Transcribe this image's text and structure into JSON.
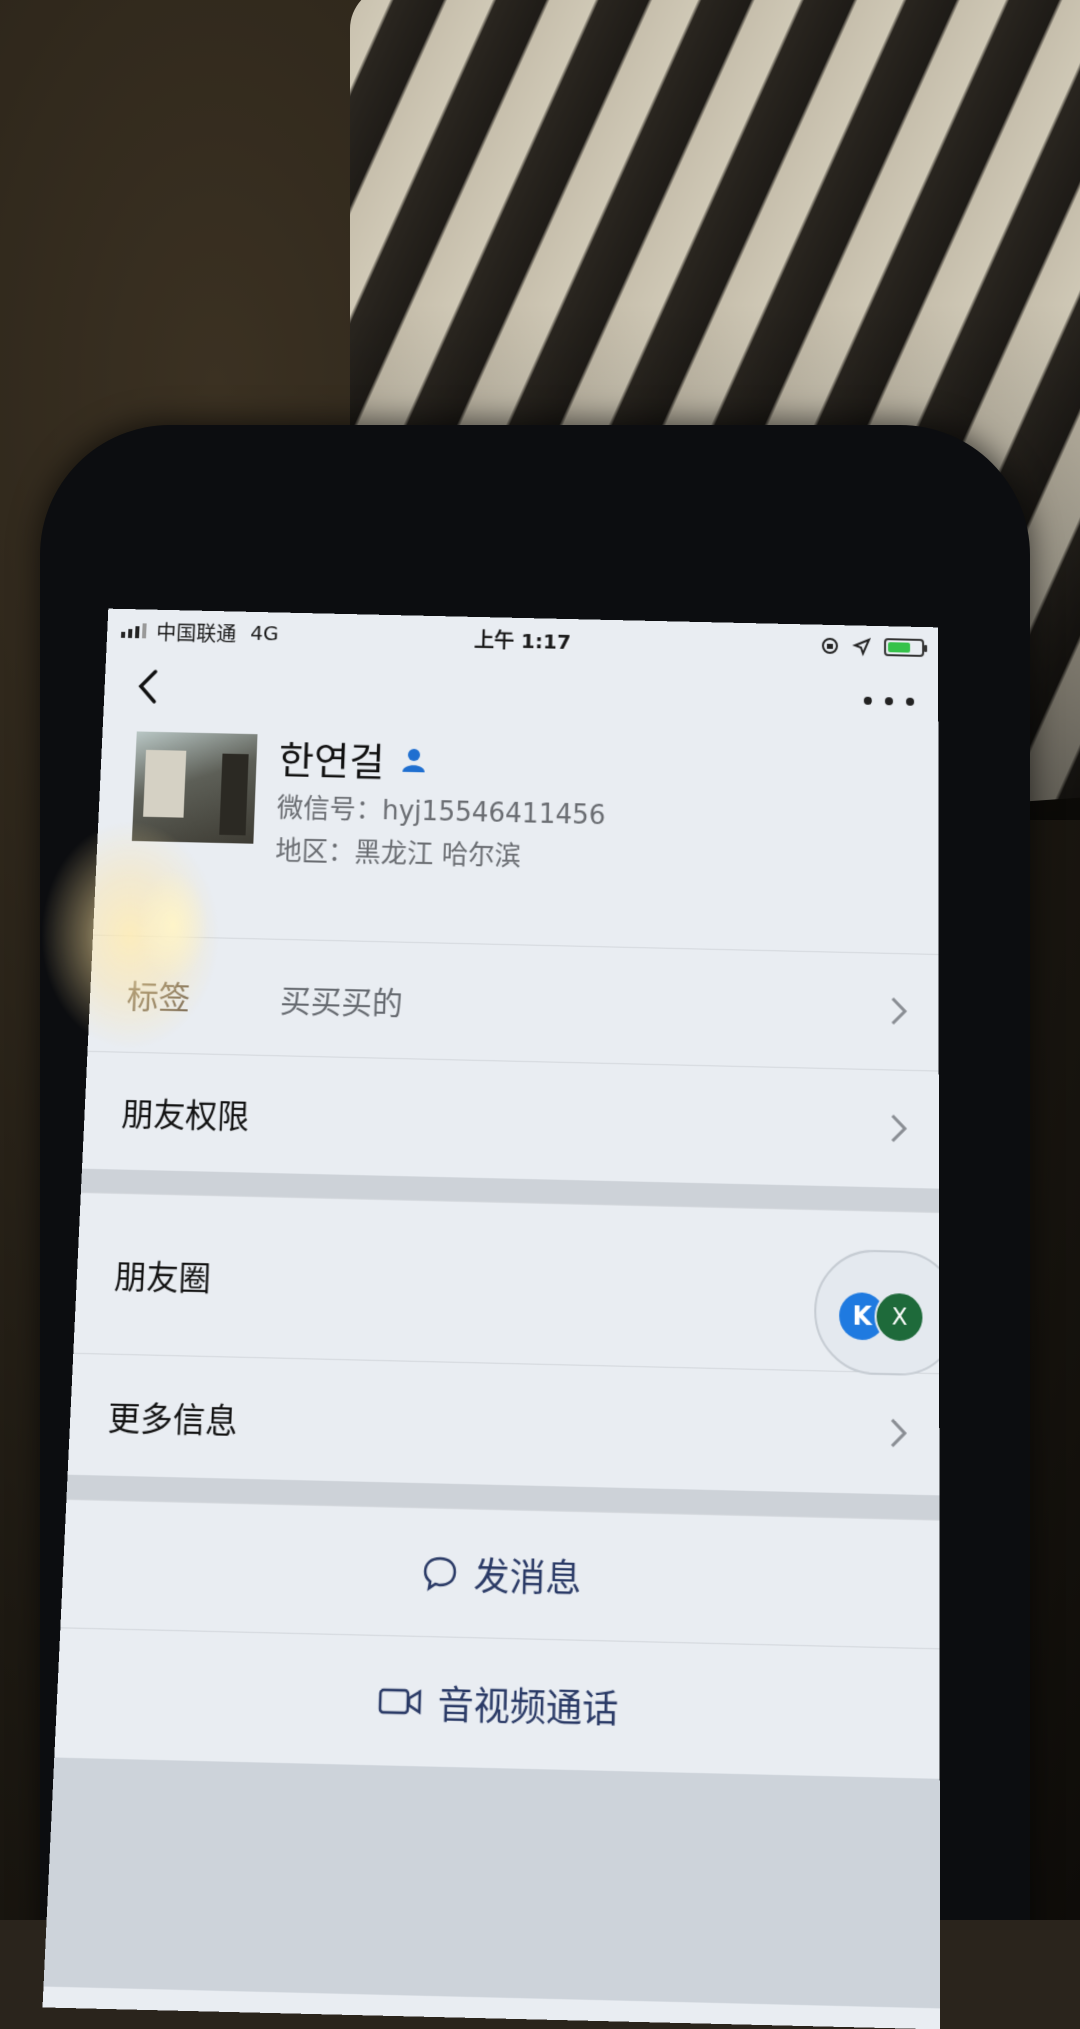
{
  "status_bar": {
    "carrier": "中国联通",
    "network": "4G",
    "time": "上午 1:17"
  },
  "profile": {
    "name": "한연걸",
    "wechat_id": "微信号：hyj15546411456",
    "region": "地区：黑龙江 哈尔滨"
  },
  "rows": {
    "tags_label": "标签",
    "tags_value": "买买买的",
    "permissions": "朋友权限",
    "moments": "朋友圈",
    "more_info": "更多信息"
  },
  "floating_bubble": {
    "k_label": "K",
    "x_label": "X"
  },
  "actions": {
    "send_message": "发消息",
    "video_call": "音视频通话"
  },
  "colors": {
    "screen_bg": "#e9edf2",
    "action_text": "#2a3a66",
    "verified_icon": "#1f6fd0",
    "battery": "#35c24a"
  },
  "icons": {
    "back": "chevron-left-icon",
    "more": "ellipsis-icon",
    "verified": "person-icon",
    "chevron": "chevron-right-icon",
    "message": "chat-bubble-icon",
    "video": "video-camera-icon"
  }
}
